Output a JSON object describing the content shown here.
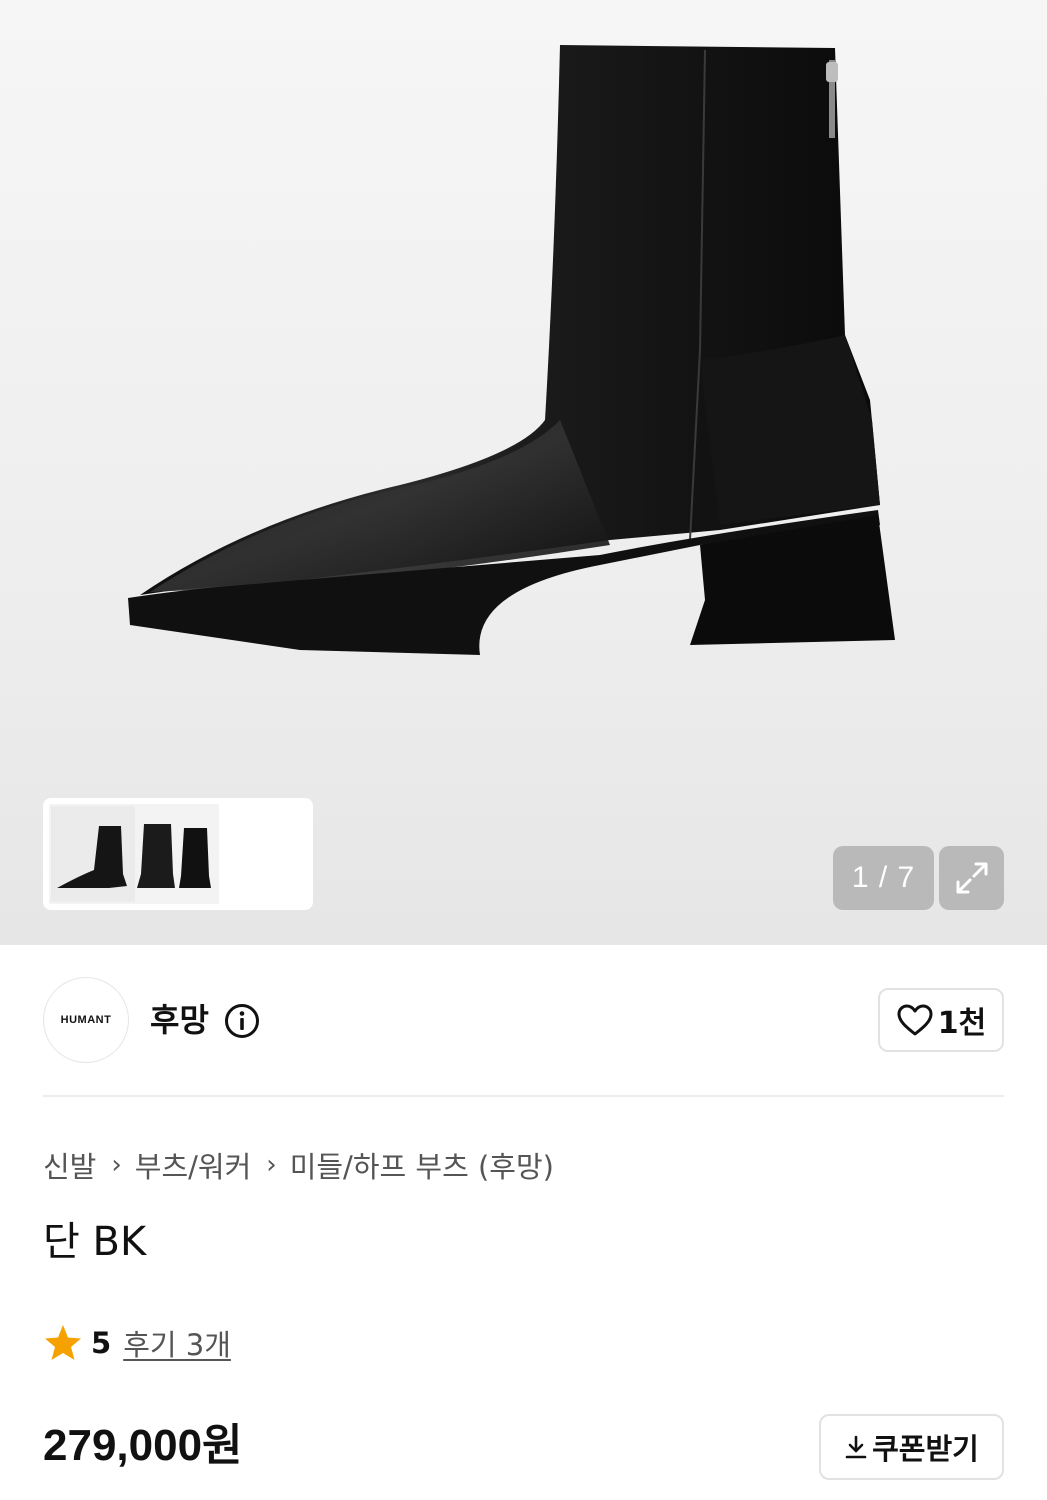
{
  "gallery": {
    "counter": "1 / 7",
    "current": 1,
    "total": 7
  },
  "brand": {
    "logo_text": "HUMANT",
    "name": "후망"
  },
  "like": {
    "count": "1천"
  },
  "breadcrumb": {
    "items": [
      "신발",
      "부츠/워커",
      "미들/하프 부츠 (후망)"
    ]
  },
  "product": {
    "title": "단 BK",
    "rating": "5",
    "review_link": "후기 3개",
    "price": "279,000원"
  },
  "coupon": {
    "label": "쿠폰받기"
  },
  "colors": {
    "star": "#f5a100",
    "overlay": "#b9b9b9"
  },
  "icons": [
    "info-icon",
    "heart-icon",
    "expand-icon",
    "star-icon",
    "download-icon",
    "chevron-right-icon"
  ]
}
